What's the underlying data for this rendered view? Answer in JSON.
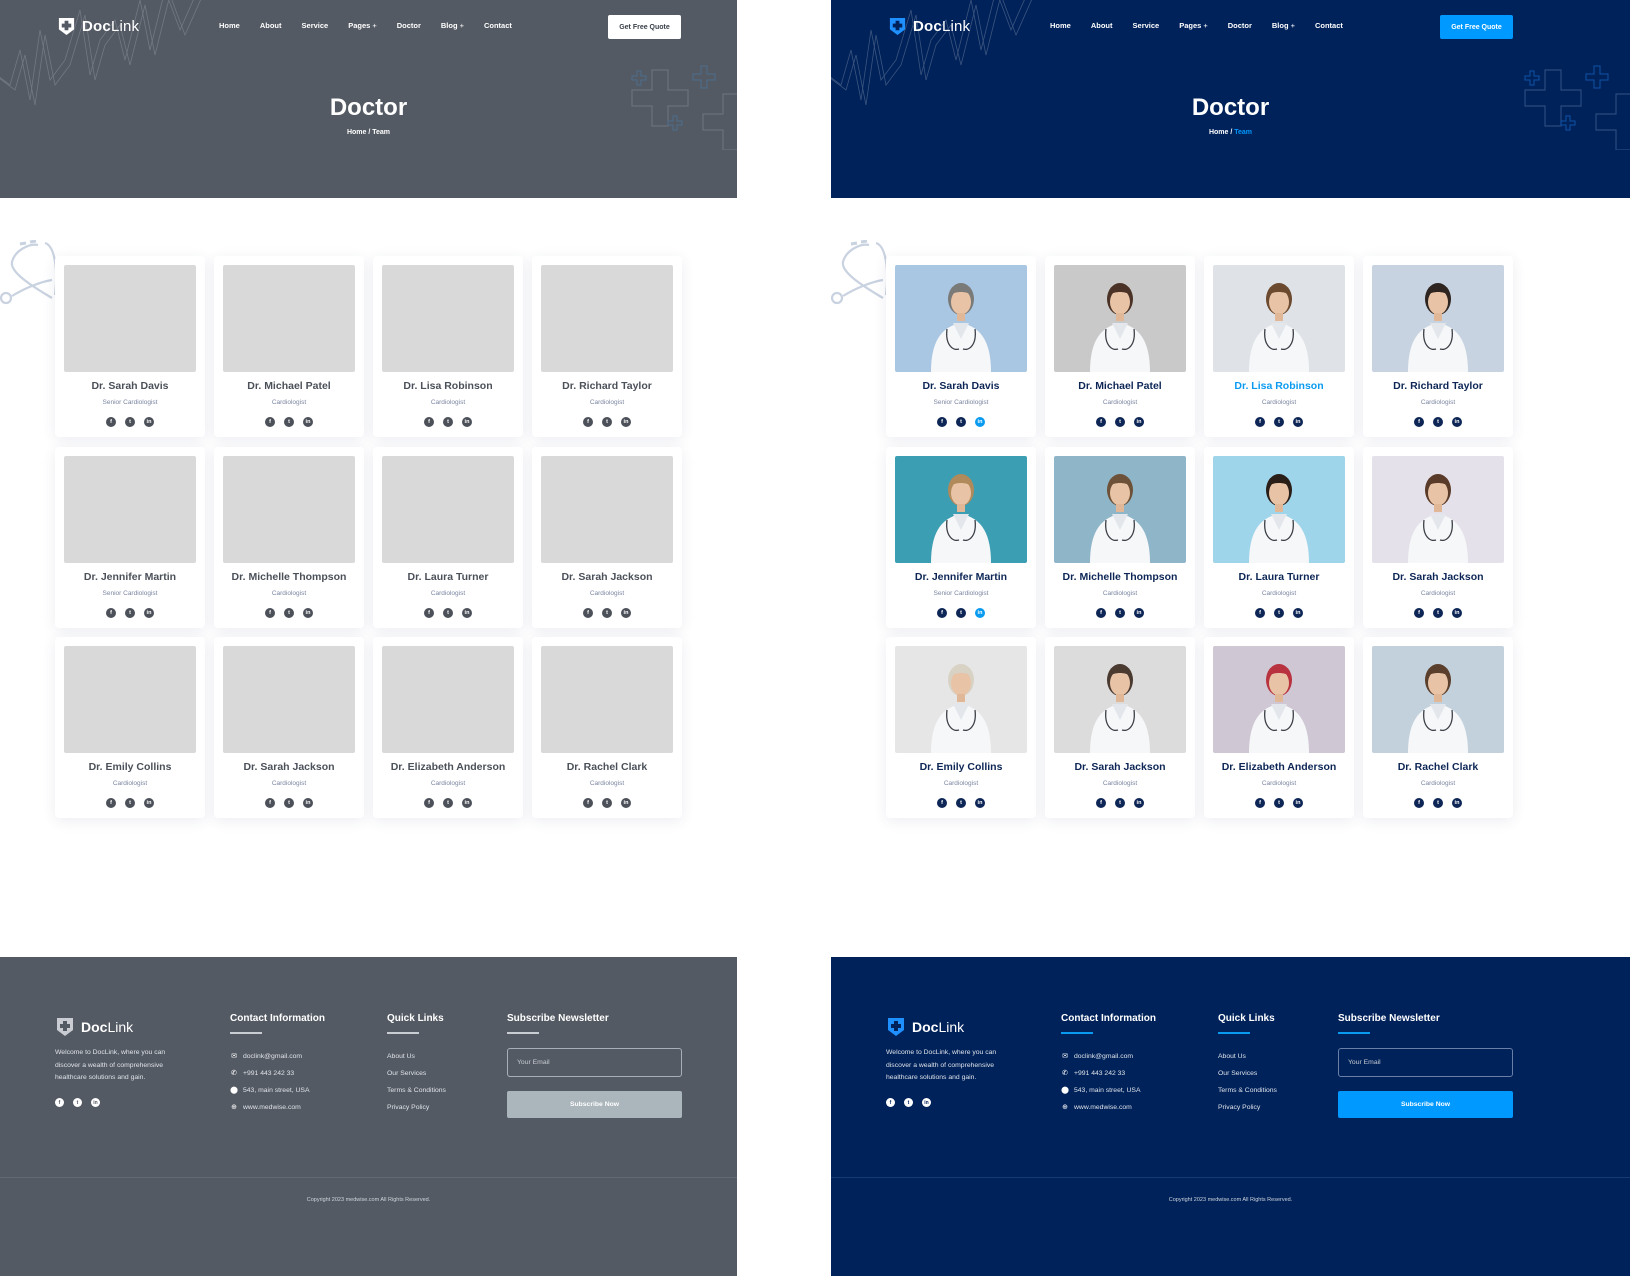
{
  "brand": {
    "name_bold": "Doc",
    "name_light": "Link"
  },
  "nav": {
    "items": [
      {
        "label": "Home",
        "has_submenu": false
      },
      {
        "label": "About",
        "has_submenu": false
      },
      {
        "label": "Service",
        "has_submenu": false
      },
      {
        "label": "Pages",
        "has_submenu": true
      },
      {
        "label": "Doctor",
        "has_submenu": false
      },
      {
        "label": "Blog",
        "has_submenu": true
      },
      {
        "label": "Contact",
        "has_submenu": false
      }
    ],
    "submenu_glyph": "+",
    "cta_label": "Get Free Quote"
  },
  "hero": {
    "title": "Doctor",
    "breadcrumb": {
      "home": "Home",
      "separator": "/",
      "current": "Team"
    }
  },
  "doctors": [
    {
      "name": "Dr. Sarah Davis",
      "role": "Senior Cardiologist",
      "photo_bg": "#a9c6e3",
      "hair": "#7a7a78",
      "highlight_social": "linkedin"
    },
    {
      "name": "Dr. Michael Patel",
      "role": "Cardiologist",
      "photo_bg": "#c9c9c9",
      "hair": "#4a3326"
    },
    {
      "name": "Dr. Lisa Robinson",
      "role": "Cardiologist",
      "photo_bg": "#dfe3e8",
      "hair": "#6b4a30",
      "active": true
    },
    {
      "name": "Dr. Richard Taylor",
      "role": "Cardiologist",
      "photo_bg": "#c7d3e0",
      "hair": "#2e2420"
    },
    {
      "name": "Dr. Jennifer Martin",
      "role": "Senior Cardiologist",
      "photo_bg": "#3c9eb3",
      "hair": "#b08a5a",
      "highlight_social": "linkedin"
    },
    {
      "name": "Dr. Michelle Thompson",
      "role": "Cardiologist",
      "photo_bg": "#8fb6c8",
      "hair": "#6d5138"
    },
    {
      "name": "Dr. Laura Turner",
      "role": "Cardiologist",
      "photo_bg": "#9fd5ea",
      "hair": "#2a1e18"
    },
    {
      "name": "Dr. Sarah Jackson",
      "role": "Cardiologist",
      "photo_bg": "#e4e1ea",
      "hair": "#5a3a28"
    },
    {
      "name": "Dr. Emily Collins",
      "role": "Cardiologist",
      "photo_bg": "#e6e6e6",
      "hair": "#d8d2c4"
    },
    {
      "name": "Dr. Sarah Jackson",
      "role": "Cardiologist",
      "photo_bg": "#dcdcdc",
      "hair": "#4a3a30"
    },
    {
      "name": "Dr. Elizabeth Anderson",
      "role": "Cardiologist",
      "photo_bg": "#cfc7d3",
      "hair": "#b8323f"
    },
    {
      "name": "Dr. Rachel Clark",
      "role": "Cardiologist",
      "photo_bg": "#c3d1dc",
      "hair": "#5a3f2c"
    }
  ],
  "social_icons": [
    {
      "name": "facebook",
      "glyph": "f"
    },
    {
      "name": "twitter",
      "glyph": "t"
    },
    {
      "name": "linkedin",
      "glyph": "in"
    }
  ],
  "footer": {
    "about": "Welcome to DocLink, where you can discover a wealth of comprehensive healthcare solutions and gain.",
    "contact": {
      "title": "Contact Information",
      "items": [
        {
          "icon": "mail-icon",
          "glyph": "✉",
          "text": "doclink@gmail.com"
        },
        {
          "icon": "phone-icon",
          "glyph": "✆",
          "text": "+991 443 242 33"
        },
        {
          "icon": "location-pin-icon",
          "glyph": "⬤",
          "text": "543, main street, USA"
        },
        {
          "icon": "globe-icon",
          "glyph": "⊕",
          "text": "www.medwise.com"
        }
      ]
    },
    "quick_links": {
      "title": "Quick Links",
      "items": [
        "About Us",
        "Our Services",
        "Terms & Conditions",
        "Privacy Policy"
      ]
    },
    "newsletter": {
      "title": "Subscribe Newsletter",
      "placeholder": "Your Email",
      "button": "Subscribe Now"
    },
    "copyright": "Copyright 2023 medwise.com All Rights Reserved."
  },
  "themes": {
    "wireframe": {
      "hero_bg": "#545a63",
      "accent": "#ffffff",
      "text_dark": "#4b5059",
      "placeholder": "#d9d9d9"
    },
    "final": {
      "hero_bg": "#00225a",
      "accent": "#0099ff",
      "text_dark": "#0d2656",
      "active_link": "#0a9bf0"
    }
  }
}
